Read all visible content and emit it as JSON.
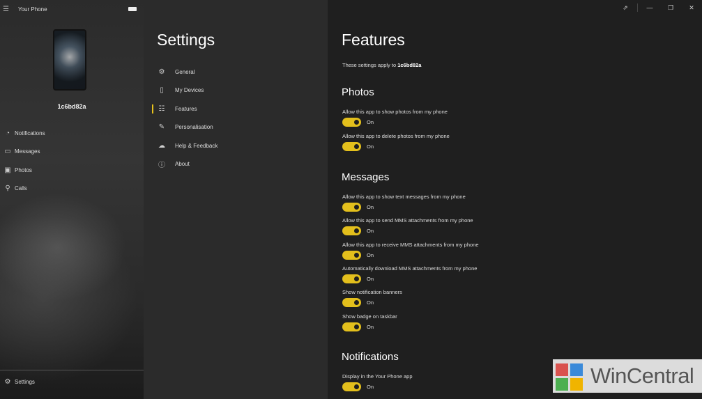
{
  "app": {
    "title": "Your Phone",
    "device_name": "1c6bd82a"
  },
  "left_nav": [
    {
      "icon": "notifications-icon",
      "glyph": "◔",
      "label": "Notifications"
    },
    {
      "icon": "messages-icon",
      "glyph": "▭",
      "label": "Messages"
    },
    {
      "icon": "photos-icon",
      "glyph": "▣",
      "label": "Photos"
    },
    {
      "icon": "calls-icon",
      "glyph": "⚲",
      "label": "Calls"
    }
  ],
  "left_footer": {
    "label": "Settings"
  },
  "settings": {
    "title": "Settings",
    "nav": [
      {
        "label": "General"
      },
      {
        "label": "My Devices"
      },
      {
        "label": "Features"
      },
      {
        "label": "Personalisation"
      },
      {
        "label": "Help & Feedback"
      },
      {
        "label": "About"
      }
    ]
  },
  "features": {
    "title": "Features",
    "applies_prefix": "These settings apply to ",
    "applies_device": "1c6bd82a",
    "sections": {
      "photos": {
        "heading": "Photos",
        "items": [
          {
            "label": "Allow this app to show photos from my phone",
            "state": "On"
          },
          {
            "label": "Allow this app to delete photos from my phone",
            "state": "On"
          }
        ]
      },
      "messages": {
        "heading": "Messages",
        "items": [
          {
            "label": "Allow this app to show text messages from my phone",
            "state": "On"
          },
          {
            "label": "Allow this app to send MMS attachments from my phone",
            "state": "On"
          },
          {
            "label": "Allow this app to receive MMS attachments from my phone",
            "state": "On"
          },
          {
            "label": "Automatically download MMS attachments from my phone",
            "state": "On"
          },
          {
            "label": "Show notification banners",
            "state": "On"
          },
          {
            "label": "Show badge on taskbar",
            "state": "On"
          }
        ]
      },
      "notifications": {
        "heading": "Notifications",
        "items": [
          {
            "label": "Display in the Your Phone app",
            "state": "On"
          }
        ]
      }
    }
  },
  "watermark": {
    "text": "WinCentral"
  },
  "colors": {
    "accent": "#e3bf1c",
    "background": "#1f1f1f",
    "panel": "#2b2b2b"
  }
}
